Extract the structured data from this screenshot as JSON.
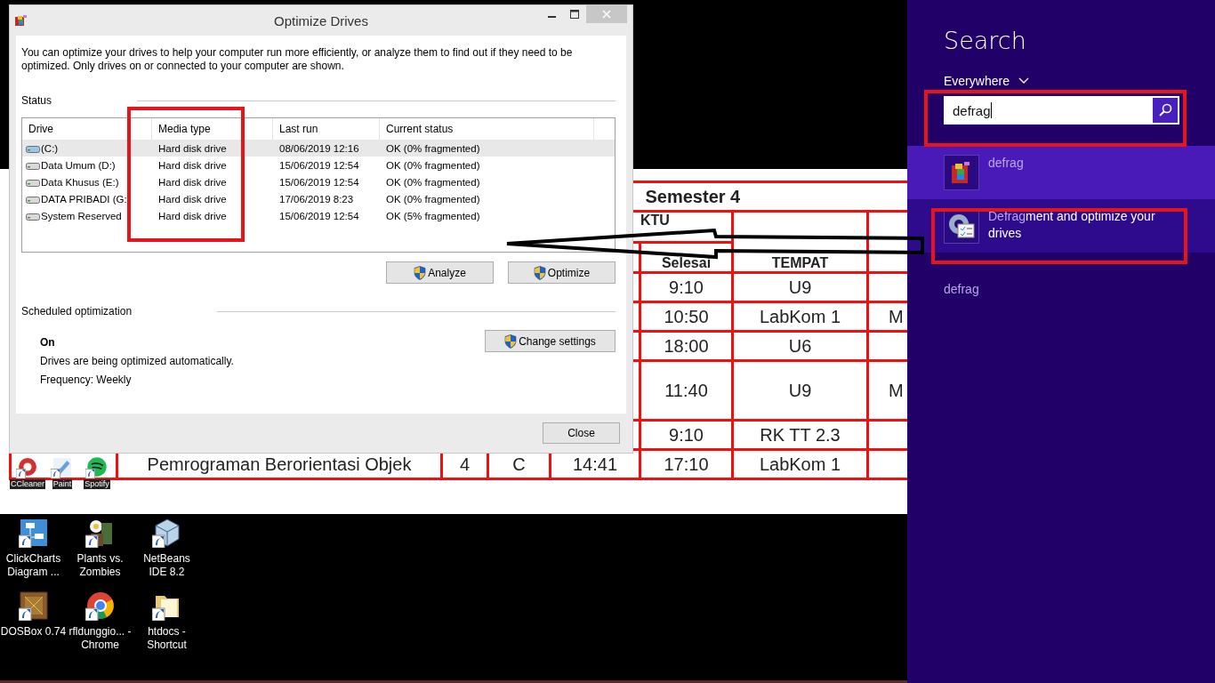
{
  "spreadsheet": {
    "title": "Semester 4",
    "header": {
      "waktu_part": "KTU",
      "selesai": "Selesai",
      "tempat": "TEMPAT"
    },
    "rows": [
      {
        "selesai": "9:10",
        "tempat": "U9",
        "tall": false
      },
      {
        "selesai": "10:50",
        "tempat": "LabKom 1",
        "column_8": "M",
        "tall": false
      },
      {
        "selesai": "18:00",
        "tempat": "U6",
        "tall": false
      },
      {
        "selesai": "11:40",
        "tempat": "U9",
        "column_8": "M",
        "tall": true
      },
      {
        "selesai": "9:10",
        "tempat": "RK TT 2.3",
        "tall": false
      }
    ],
    "last_row": {
      "course": "Pemrograman Berorientasi Objek",
      "column_3": "4",
      "column_4": "C",
      "mulai": "14:41",
      "selesai": "17:10",
      "tempat": "LabKom 1"
    }
  },
  "overlapped_icons": [
    {
      "label": "CCleaner",
      "kind": "ccleaner"
    },
    {
      "label": "Paint",
      "kind": "paint"
    },
    {
      "label": "Spotify",
      "kind": "spotify"
    }
  ],
  "desktop_icons": [
    {
      "label": "ClickCharts Diagram ...",
      "kind": "chart"
    },
    {
      "label": "Plants vs. Zombies",
      "kind": "game"
    },
    {
      "label": "NetBeans IDE 8.2",
      "kind": "cube"
    },
    {
      "label": "DOSBox 0.74",
      "kind": "box"
    },
    {
      "label": "rfldunggio... - Chrome",
      "kind": "chrome"
    },
    {
      "label": "htdocs - Shortcut",
      "kind": "folder"
    }
  ],
  "dialog": {
    "title": "Optimize Drives",
    "intro": "You can optimize your drives to help your computer run more efficiently, or analyze them to find out if they need to be optimized. Only drives on or connected to your computer are shown.",
    "status_label": "Status",
    "columns": [
      "Drive",
      "Media type",
      "Last run",
      "Current status"
    ],
    "drives": [
      {
        "drive": "(C:)",
        "media": "Hard disk drive",
        "last_run": "08/06/2019 12:16",
        "status": "OK (0% fragmented)",
        "selected": true,
        "kind": "system"
      },
      {
        "drive": "Data Umum (D:)",
        "media": "Hard disk drive",
        "last_run": "15/06/2019 12:54",
        "status": "OK (0% fragmented)",
        "selected": false,
        "kind": "disk"
      },
      {
        "drive": "Data Khusus (E:)",
        "media": "Hard disk drive",
        "last_run": "15/06/2019 12:54",
        "status": "OK (0% fragmented)",
        "selected": false,
        "kind": "disk"
      },
      {
        "drive": "DATA PRIBADI (G:",
        "media": "Hard disk drive",
        "last_run": "17/06/2019 8:23",
        "status": "OK (0% fragmented)",
        "selected": false,
        "kind": "disk"
      },
      {
        "drive": "System Reserved",
        "media": "Hard disk drive",
        "last_run": "15/06/2019 12:54",
        "status": "OK (5% fragmented)",
        "selected": false,
        "kind": "disk"
      }
    ],
    "buttons": [
      "Analyze",
      "Optimize"
    ],
    "scheduled_label": "Scheduled optimization",
    "schedule_state": "On",
    "schedule_text": "Drives are being optimized automatically.",
    "frequency": "Frequency: Weekly",
    "change_button": "Change settings",
    "close_button": "Close"
  },
  "search_pane": {
    "title": "Search",
    "scope": "Everywhere",
    "query": "defrag",
    "results": [
      {
        "matched": "defrag",
        "selected": true,
        "kind": "defrag"
      },
      {
        "matched": "Defrag",
        "rest": "ment and optimize your drives",
        "selected": false,
        "kind": "settings"
      }
    ],
    "suggestions": [
      "defrag"
    ]
  }
}
